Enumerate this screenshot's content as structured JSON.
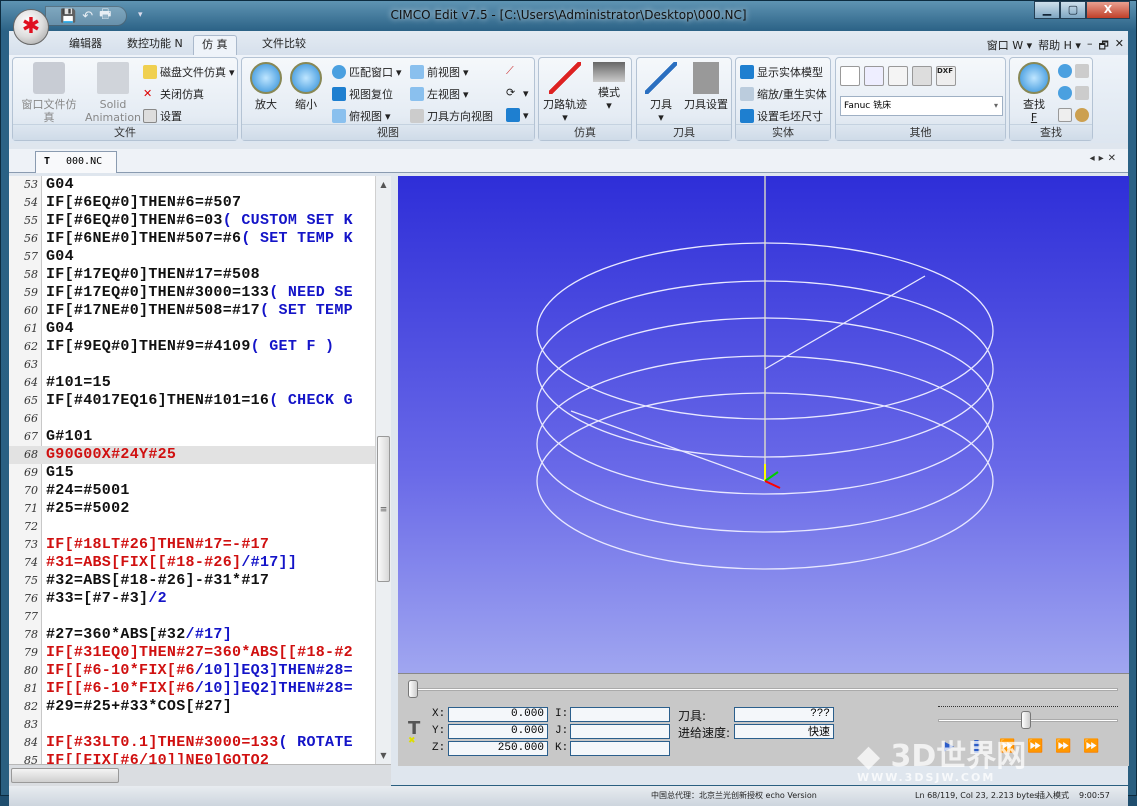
{
  "window": {
    "title": "CIMCO Edit v7.5 - [C:\\Users\\Administrator\\Desktop\\000.NC]",
    "min": "▁",
    "max": "▢",
    "close": "X"
  },
  "ribbon_tabs": [
    {
      "label": "编辑器"
    },
    {
      "label": "数控功能 N"
    },
    {
      "label": "仿 真",
      "active": true
    },
    {
      "label": "文件比较"
    }
  ],
  "menu_right": {
    "window": "窗口 W ▾",
    "help": "帮助 H ▾",
    "min": "–",
    "restore": "🗗",
    "close": "✕"
  },
  "groups": {
    "file": {
      "label": "文件",
      "window_sim": "窗口文件仿真",
      "solid": "Solid Animation",
      "disk_sim": "磁盘文件仿真",
      "close_sim": "关闭仿真",
      "settings": "设置"
    },
    "view": {
      "label": "视图",
      "zoom_in": "放大",
      "zoom_out": "缩小",
      "fit": "匹配窗口",
      "reset": "视图复位",
      "top": "俯视图",
      "front": "前视图",
      "left": "左视图",
      "tool_dir": "刀具方向视图"
    },
    "sim": {
      "label": "仿真",
      "toolpath": "刀路轨迹",
      "mode": "模式"
    },
    "tool": {
      "label": "刀具",
      "tool": "刀具",
      "tool_setup": "刀具设置"
    },
    "solid": {
      "label": "实体",
      "show": "显示实体模型",
      "zoom_regen": "缩放/重生实体",
      "stock": "设置毛坯尺寸"
    },
    "other": {
      "label": "其他",
      "machine": "Fanuc 铣床"
    },
    "find": {
      "label": "查找",
      "find": "查找",
      "key": "F"
    }
  },
  "document_tab": "000.NC",
  "editor": {
    "lines": [
      {
        "n": "53",
        "s": [
          [
            "k",
            "G04"
          ]
        ]
      },
      {
        "n": "54",
        "s": [
          [
            "k",
            "IF[#6EQ#0]THEN#6=#507"
          ]
        ]
      },
      {
        "n": "55",
        "s": [
          [
            "k",
            "IF[#6EQ#0]THEN#6=03"
          ],
          [
            "b",
            "( CUSTOM SET K"
          ]
        ]
      },
      {
        "n": "56",
        "s": [
          [
            "k",
            "IF[#6NE#0]THEN#507=#6"
          ],
          [
            "b",
            "( SET TEMP K"
          ]
        ]
      },
      {
        "n": "57",
        "s": [
          [
            "k",
            "G04"
          ]
        ]
      },
      {
        "n": "58",
        "s": [
          [
            "k",
            "IF[#17EQ#0]THEN#17=#508"
          ]
        ]
      },
      {
        "n": "59",
        "s": [
          [
            "k",
            "IF[#17EQ#0]THEN#3000=133"
          ],
          [
            "b",
            "( NEED SE"
          ]
        ]
      },
      {
        "n": "60",
        "s": [
          [
            "k",
            "IF[#17NE#0]THEN#508=#17"
          ],
          [
            "b",
            "( SET TEMP"
          ]
        ]
      },
      {
        "n": "61",
        "s": [
          [
            "k",
            "G04"
          ]
        ]
      },
      {
        "n": "62",
        "s": [
          [
            "k",
            "IF[#9EQ#0]THEN#9=#4109"
          ],
          [
            "b",
            "( GET F )"
          ]
        ]
      },
      {
        "n": "63",
        "s": []
      },
      {
        "n": "64",
        "s": [
          [
            "k",
            "#101=15"
          ]
        ]
      },
      {
        "n": "65",
        "s": [
          [
            "k",
            "IF[#4017EQ16]THEN#101=16"
          ],
          [
            "b",
            "( CHECK G"
          ]
        ]
      },
      {
        "n": "66",
        "s": []
      },
      {
        "n": "67",
        "s": [
          [
            "k",
            "G#101"
          ]
        ]
      },
      {
        "n": "68",
        "s": [
          [
            "r",
            "G90G00X#24Y#25"
          ]
        ],
        "current": true
      },
      {
        "n": "69",
        "s": [
          [
            "k",
            "G15"
          ]
        ]
      },
      {
        "n": "70",
        "s": [
          [
            "k",
            "#24=#5001"
          ]
        ]
      },
      {
        "n": "71",
        "s": [
          [
            "k",
            "#25=#5002"
          ]
        ]
      },
      {
        "n": "72",
        "s": []
      },
      {
        "n": "73",
        "s": [
          [
            "r",
            "IF[#18LT#26]THEN#17=-#17"
          ]
        ]
      },
      {
        "n": "74",
        "s": [
          [
            "r",
            "#31=ABS[FIX[[#18-#26]"
          ],
          [
            "b",
            "/#17]]"
          ]
        ]
      },
      {
        "n": "75",
        "s": [
          [
            "k",
            "#32=ABS[#18-#26]-#31*#17"
          ]
        ]
      },
      {
        "n": "76",
        "s": [
          [
            "k",
            "#33=[#7-#3]"
          ],
          [
            "b",
            "/2"
          ]
        ]
      },
      {
        "n": "77",
        "s": []
      },
      {
        "n": "78",
        "s": [
          [
            "k",
            "#27=360*ABS[#32"
          ],
          [
            "b",
            "/#17]"
          ]
        ]
      },
      {
        "n": "79",
        "s": [
          [
            "r",
            "IF[#31EQ0]THEN#27=360*ABS[[#18-#2"
          ]
        ]
      },
      {
        "n": "80",
        "s": [
          [
            "r",
            "IF[[#6-10*FIX[#6"
          ],
          [
            "b",
            "/10]]EQ3]THEN#28="
          ]
        ]
      },
      {
        "n": "81",
        "s": [
          [
            "r",
            "IF[[#6-10*FIX[#6"
          ],
          [
            "b",
            "/10]]EQ2]THEN#28="
          ]
        ]
      },
      {
        "n": "82",
        "s": [
          [
            "k",
            "#29=#25+#33*COS[#27]"
          ]
        ]
      },
      {
        "n": "83",
        "s": []
      },
      {
        "n": "84",
        "s": [
          [
            "r",
            "IF[#33LT0.1]THEN#3000=133"
          ],
          [
            "b",
            "( ROTATE"
          ]
        ]
      },
      {
        "n": "85",
        "s": [
          [
            "r",
            "IF[[FIX[#6/10]]NE0]GOTO2"
          ]
        ]
      }
    ]
  },
  "sim_panel": {
    "x_label": "X:",
    "x": "0.000",
    "y_label": "Y:",
    "y": "0.000",
    "z_label": "Z:",
    "z": "250.000",
    "i_label": "I:",
    "j_label": "J:",
    "k_label": "K:",
    "i": "",
    "j": "",
    "k": "",
    "tool_label": "刀具:",
    "tool": "???",
    "feed_label": "进给速度:",
    "feed": "快速"
  },
  "status": {
    "agent": "中国总代理：北京兰光创新授权 echo Version",
    "position": "Ln 68/119, Col 23, 2.213 bytes",
    "mode": "插入模式",
    "time": "9:00:57"
  },
  "watermark": {
    "text": "3D世界网",
    "url": "WWW.3DSJW.COM"
  },
  "colors": {
    "view_bg_top": "#2e2ed8",
    "view_bg_bottom": "#a0a6f0",
    "keyword_red": "#d01010",
    "comment_blue": "#1414c8"
  }
}
